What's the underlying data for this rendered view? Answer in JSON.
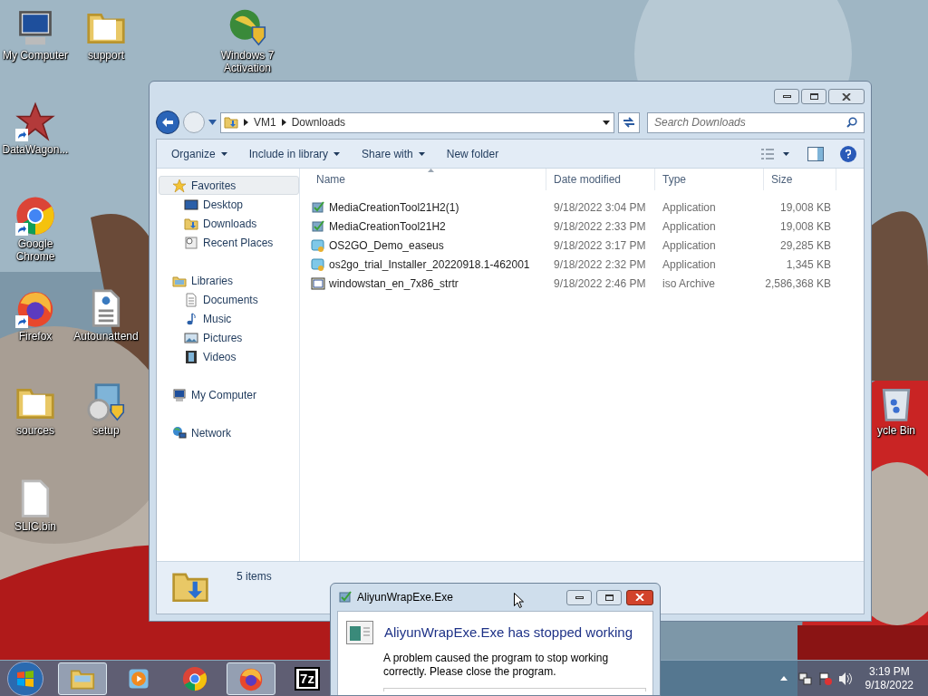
{
  "desktop_icons": [
    {
      "label": "My Computer",
      "kind": "computer",
      "shortcut": false
    },
    {
      "label": "support",
      "kind": "folder",
      "shortcut": false
    },
    {
      "label": "Windows 7 Activation",
      "kind": "activation",
      "shortcut": false
    },
    {
      "label": "DataWagon...",
      "kind": "star",
      "shortcut": true
    },
    {
      "label": "Google Chrome",
      "kind": "chrome",
      "shortcut": true
    },
    {
      "label": "Firefox",
      "kind": "firefox",
      "shortcut": true
    },
    {
      "label": "Autounattend",
      "kind": "document",
      "shortcut": false
    },
    {
      "label": "sources",
      "kind": "folder",
      "shortcut": false
    },
    {
      "label": "setup",
      "kind": "setup",
      "shortcut": false
    },
    {
      "label": "SLIC.bin",
      "kind": "file",
      "shortcut": false
    },
    {
      "label": "ycle Bin",
      "kind": "recycle",
      "shortcut": false
    }
  ],
  "explorer": {
    "breadcrumb": [
      "VM1",
      "Downloads"
    ],
    "search": {
      "placeholder": "Search Downloads"
    },
    "toolbar": [
      {
        "label": "Organize",
        "dropdown": true
      },
      {
        "label": "Include in library",
        "dropdown": true
      },
      {
        "label": "Share with",
        "dropdown": true
      },
      {
        "label": "New folder",
        "dropdown": false
      }
    ],
    "nav": [
      {
        "label": "Favorites",
        "kind": "star",
        "selected": true,
        "children": [
          {
            "label": "Desktop",
            "kind": "desktop",
            "selected": false
          },
          {
            "label": "Downloads",
            "kind": "downloads",
            "selected": false
          },
          {
            "label": "Recent Places",
            "kind": "recent",
            "selected": false
          }
        ]
      },
      {
        "label": "Libraries",
        "kind": "library",
        "selected": false,
        "children": [
          {
            "label": "Documents",
            "kind": "documents",
            "selected": false
          },
          {
            "label": "Music",
            "kind": "music",
            "selected": false
          },
          {
            "label": "Pictures",
            "kind": "pictures",
            "selected": false
          },
          {
            "label": "Videos",
            "kind": "videos",
            "selected": false
          }
        ]
      },
      {
        "label": "My Computer",
        "kind": "computer",
        "selected": false
      },
      {
        "label": "Network",
        "kind": "network",
        "selected": false
      }
    ],
    "columns": [
      {
        "label": "Name",
        "sorted": true
      },
      {
        "label": "Date modified",
        "sorted": false
      },
      {
        "label": "Type",
        "sorted": false
      },
      {
        "label": "Size",
        "sorted": false
      }
    ],
    "files": [
      {
        "name": "MediaCreationTool21H2(1)",
        "date": "9/18/2022 3:04 PM",
        "type": "Application",
        "size": "19,008 KB",
        "kind": "installer"
      },
      {
        "name": "MediaCreationTool21H2",
        "date": "9/18/2022 2:33 PM",
        "type": "Application",
        "size": "19,008 KB",
        "kind": "installer"
      },
      {
        "name": "OS2GO_Demo_easeus",
        "date": "9/18/2022 3:17 PM",
        "type": "Application",
        "size": "29,285 KB",
        "kind": "app"
      },
      {
        "name": "os2go_trial_Installer_20220918.1-462001",
        "date": "9/18/2022 2:32 PM",
        "type": "Application",
        "size": "1,345 KB",
        "kind": "app"
      },
      {
        "name": "windowstan_en_7x86_strtr",
        "date": "9/18/2022 2:46 PM",
        "type": "iso Archive",
        "size": "2,586,368 KB",
        "kind": "iso"
      }
    ],
    "status": "5 items"
  },
  "dialog": {
    "title": "AliyunWrapExe.Exe",
    "heading": "AliyunWrapExe.Exe has stopped working",
    "message": "A problem caused the program to stop working correctly. Please close the program."
  },
  "taskbar": {
    "items": [
      {
        "kind": "explorer",
        "active": true
      },
      {
        "kind": "media",
        "active": false
      },
      {
        "kind": "chrome",
        "active": false
      },
      {
        "kind": "firefox",
        "active": true
      },
      {
        "kind": "archiver",
        "active": false,
        "label": "7z"
      }
    ],
    "time": "3:19 PM",
    "date": "9/18/2022"
  }
}
